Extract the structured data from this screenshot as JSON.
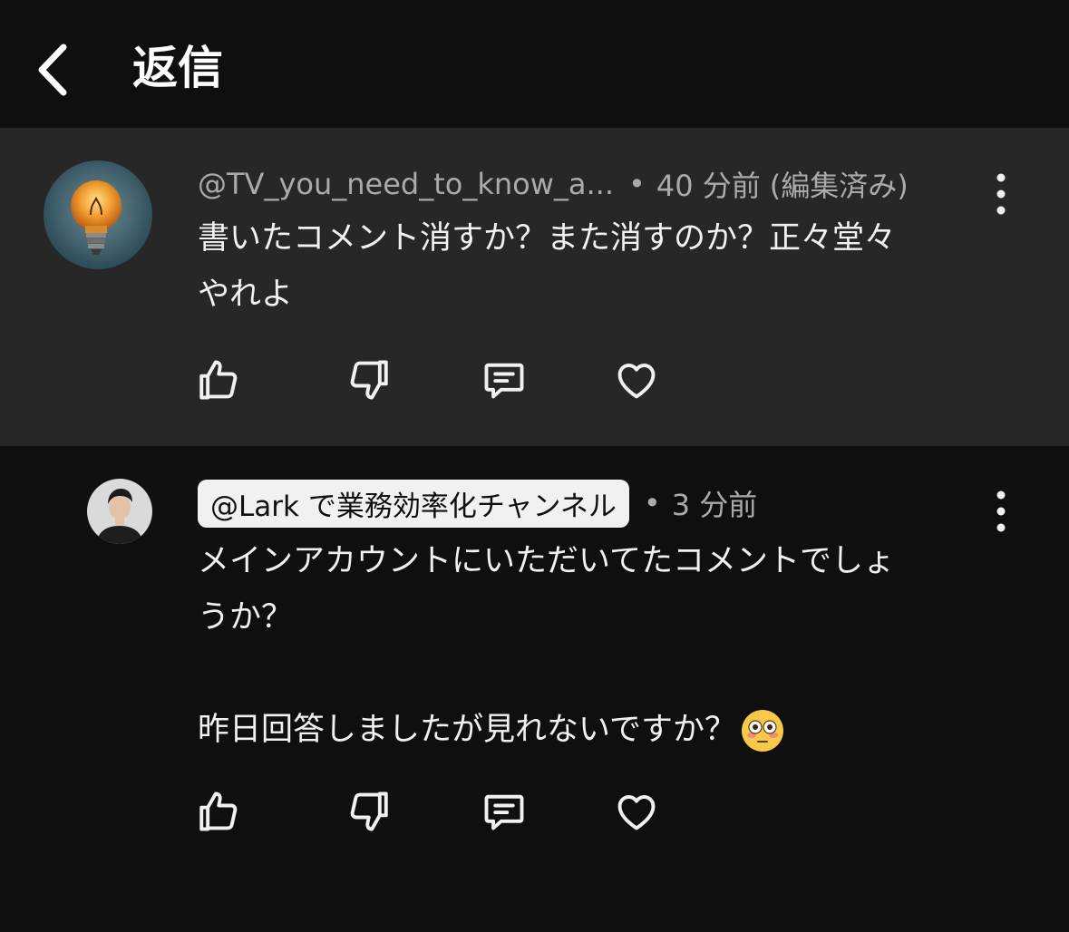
{
  "header": {
    "title": "返信"
  },
  "parent_comment": {
    "author": "@TV_you_need_to_know_a...",
    "time": "40 分前",
    "edited": "(編集済み)",
    "text": "書いたコメント消すか？また消すのか？正々堂々\nやれよ",
    "avatar": "lightbulb-avatar"
  },
  "reply_comment": {
    "author": "@Lark で業務効率化チャンネル",
    "time": "3 分前",
    "text": "メインアカウントにいただいてたコメントでしょ\nうか？\n\n昨日回答しましたが見れないですか？",
    "emoji": "flushed-face"
  },
  "separator": "•",
  "icons": {
    "back": "chevron-left-icon",
    "more": "more-vertical-icon",
    "like": "thumbs-up-icon",
    "dislike": "thumbs-down-icon",
    "reply": "comment-icon",
    "heart": "heart-icon"
  },
  "colors": {
    "background": "#0f0f0f",
    "highlight": "#272727",
    "text": "#f1f1f1",
    "secondary": "#aaaaaa"
  }
}
